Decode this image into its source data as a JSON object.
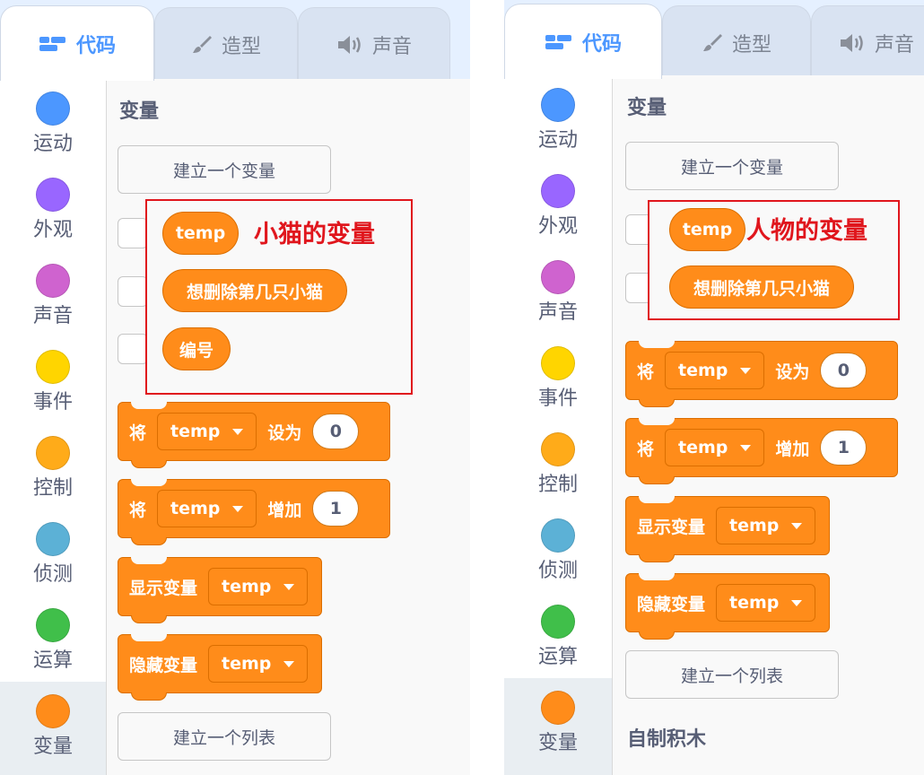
{
  "left": {
    "tabs": [
      {
        "label": "代码",
        "icon": "code-icon"
      },
      {
        "label": "造型",
        "icon": "brush-icon"
      },
      {
        "label": "声音",
        "icon": "speaker-icon"
      }
    ],
    "categories": [
      {
        "label": "运动",
        "color": "#4c97ff"
      },
      {
        "label": "外观",
        "color": "#9966ff"
      },
      {
        "label": "声音",
        "color": "#cf63cf"
      },
      {
        "label": "事件",
        "color": "#ffd500"
      },
      {
        "label": "控制",
        "color": "#ffab19"
      },
      {
        "label": "侦测",
        "color": "#5cb1d6"
      },
      {
        "label": "运算",
        "color": "#40bf4a"
      },
      {
        "label": "变量",
        "color": "#ff8c1a"
      }
    ],
    "section_title": "变量",
    "make_variable": "建立一个变量",
    "variables": [
      "temp",
      "想删除第几只小猫",
      "编号"
    ],
    "annotation": "小猫的变量",
    "set_block": {
      "prefix": "将",
      "var": "temp",
      "verb": "设为",
      "value": "0"
    },
    "change_block": {
      "prefix": "将",
      "var": "temp",
      "verb": "增加",
      "value": "1"
    },
    "show_block": {
      "label": "显示变量",
      "var": "temp"
    },
    "hide_block": {
      "label": "隐藏变量",
      "var": "temp"
    },
    "make_list": "建立一个列表"
  },
  "right": {
    "tabs": [
      {
        "label": "代码",
        "icon": "code-icon"
      },
      {
        "label": "造型",
        "icon": "brush-icon"
      },
      {
        "label": "声音",
        "icon": "speaker-icon"
      }
    ],
    "categories": [
      {
        "label": "运动",
        "color": "#4c97ff"
      },
      {
        "label": "外观",
        "color": "#9966ff"
      },
      {
        "label": "声音",
        "color": "#cf63cf"
      },
      {
        "label": "事件",
        "color": "#ffd500"
      },
      {
        "label": "控制",
        "color": "#ffab19"
      },
      {
        "label": "侦测",
        "color": "#5cb1d6"
      },
      {
        "label": "运算",
        "color": "#40bf4a"
      },
      {
        "label": "变量",
        "color": "#ff8c1a"
      }
    ],
    "section_title": "变量",
    "make_variable": "建立一个变量",
    "variables": [
      "temp",
      "想删除第几只小猫"
    ],
    "annotation": "人物的变量",
    "set_block": {
      "prefix": "将",
      "var": "temp",
      "verb": "设为",
      "value": "0"
    },
    "change_block": {
      "prefix": "将",
      "var": "temp",
      "verb": "增加",
      "value": "1"
    },
    "show_block": {
      "label": "显示变量",
      "var": "temp"
    },
    "hide_block": {
      "label": "隐藏变量",
      "var": "temp"
    },
    "make_list": "建立一个列表",
    "my_blocks_title": "自制积木"
  },
  "colors": {
    "accent": "#4c97ff",
    "variables_orange": "#ff8c1a",
    "annotation_red": "#e0161d",
    "selected_category_bg": "#e9eef2"
  }
}
